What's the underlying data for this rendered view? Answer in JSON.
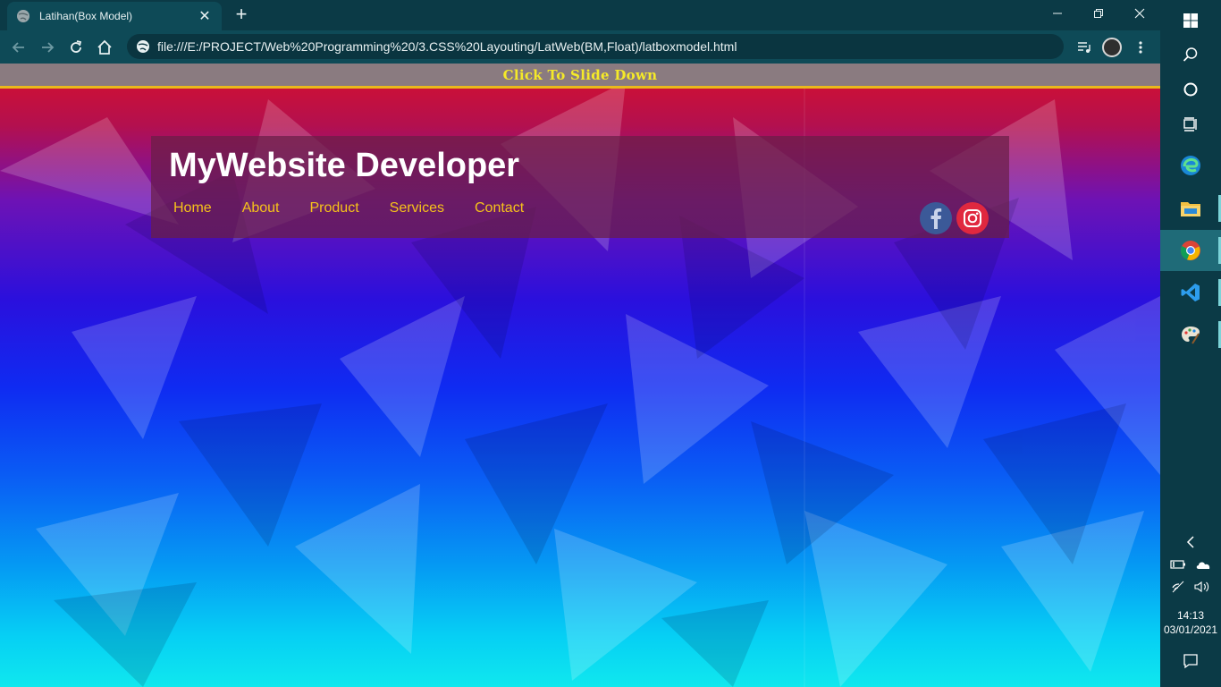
{
  "browser": {
    "tab": {
      "title": "Latihan(Box Model)"
    },
    "address": {
      "url": "file:///E:/PROJECT/Web%20Programming%20/3.CSS%20Layouting/LatWeb(BM,Float)/latboxmodel.html"
    }
  },
  "page": {
    "slide_bar": {
      "label": "Click To Slide Down"
    },
    "site_title": "MyWebsite Developer",
    "nav": [
      "Home",
      "About",
      "Product",
      "Services",
      "Contact"
    ],
    "social": [
      "facebook-icon",
      "instagram-icon"
    ],
    "colors": {
      "nav_link": "#f6c21a",
      "slide_text": "#f5ea28",
      "slide_border": "#e9b91c"
    }
  },
  "taskbar": {
    "apps": [
      "windows-start-icon",
      "search-icon",
      "cortana-icon",
      "task-view-icon",
      "edge-icon",
      "file-explorer-icon",
      "chrome-icon",
      "vscode-icon",
      "paint-icon"
    ],
    "time": "14:13",
    "date": "03/01/2021"
  }
}
